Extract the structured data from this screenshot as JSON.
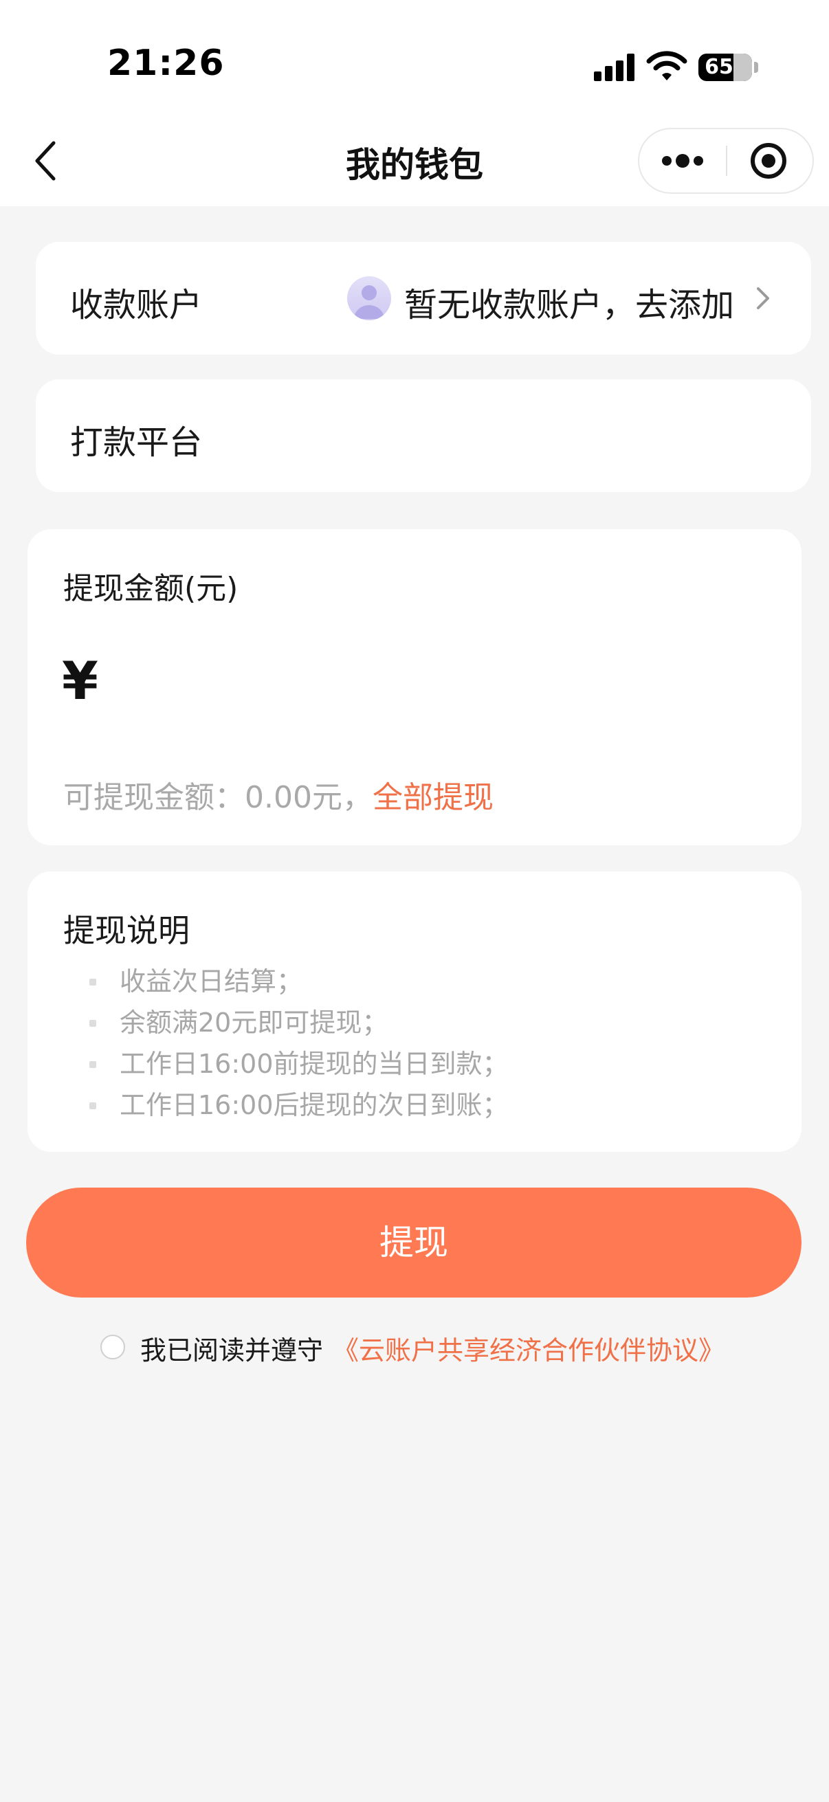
{
  "status_bar": {
    "time": "21:26",
    "battery": "65",
    "battery_level": 0.65
  },
  "nav": {
    "title": "我的钱包"
  },
  "account": {
    "label": "收款账户",
    "value": "暂无收款账户，去添加"
  },
  "platform": {
    "label": "打款平台"
  },
  "amount": {
    "label": "提现金额(元)",
    "currency_symbol": "¥",
    "input_value": "",
    "available_text": "可提现金额：0.00元，",
    "withdraw_all_label": "全部提现"
  },
  "notes": {
    "title": "提现说明",
    "items": [
      "收益次日结算；",
      "余额满20元即可提现；",
      "工作日16:00前提现的当日到款；",
      "工作日16:00后提现的次日到账；"
    ]
  },
  "submit": {
    "label": "提现"
  },
  "agreement": {
    "prefix": "我已阅读并遵守",
    "link": "《云账户共享经济合作伙伴协议》",
    "checked": false
  },
  "colors": {
    "accent": "#ff7a52",
    "link": "#f07048",
    "background": "#f5f5f5",
    "muted_text": "#a9a9a9"
  },
  "icons": {
    "back": "chevron-left-icon",
    "more": "more-dots-icon",
    "close": "target-circle-icon",
    "account_avatar": "user-avatar-icon",
    "account_chevron": "chevron-right-icon"
  }
}
